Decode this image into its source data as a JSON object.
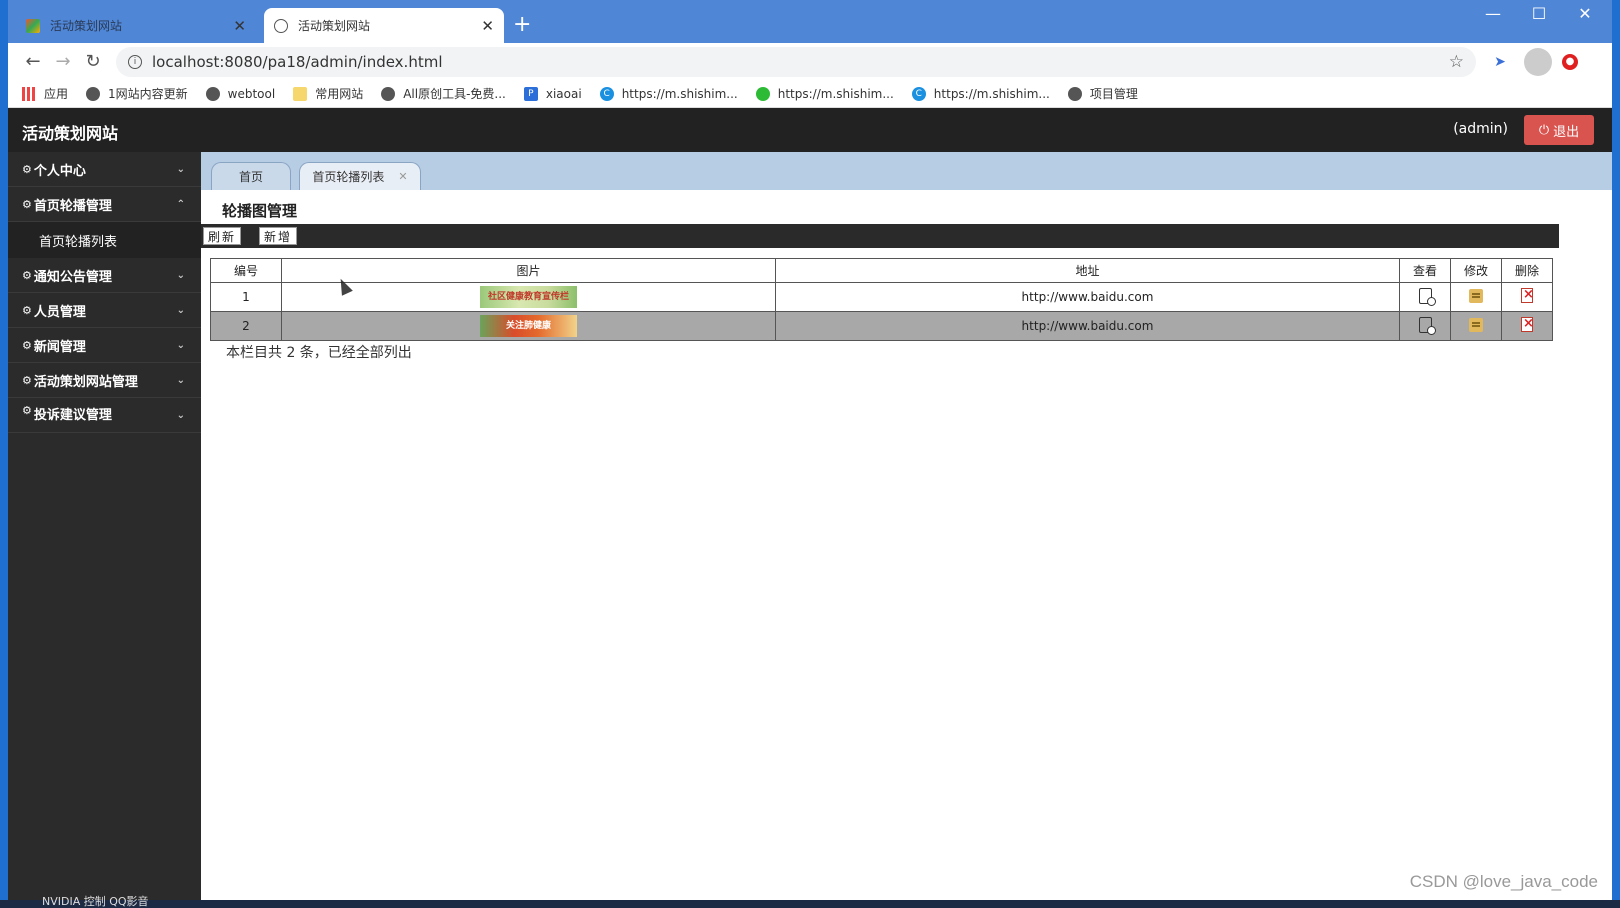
{
  "browser": {
    "tabs": [
      {
        "title": "活动策划网站",
        "active": false
      },
      {
        "title": "活动策划网站",
        "active": true
      }
    ],
    "url": "localhost:8080/pa18/admin/index.html",
    "bookmarks": [
      {
        "label": "应用",
        "icon": "apps-grid-icon"
      },
      {
        "label": "1网站内容更新",
        "icon": "globe-icon"
      },
      {
        "label": "webtool",
        "icon": "globe-icon"
      },
      {
        "label": "常用网站",
        "icon": "folder-icon"
      },
      {
        "label": "All原创工具-免费...",
        "icon": "globe-icon"
      },
      {
        "label": "xiaoai",
        "icon": "p-icon"
      },
      {
        "label": "https://m.shishim...",
        "icon": "c-icon"
      },
      {
        "label": "https://m.shishim...",
        "icon": "wechat-icon"
      },
      {
        "label": "https://m.shishim...",
        "icon": "c-icon"
      },
      {
        "label": "项目管理",
        "icon": "globe-icon"
      }
    ]
  },
  "header": {
    "title": "活动策划网站",
    "user": "(admin)",
    "logout_label": "退出",
    "logout_color": "#d9534f"
  },
  "sidebar": {
    "items": [
      {
        "label": "个人中心",
        "expanded": false
      },
      {
        "label": "首页轮播管理",
        "expanded": true,
        "children": [
          {
            "label": "首页轮播列表"
          }
        ]
      },
      {
        "label": "通知公告管理",
        "expanded": false
      },
      {
        "label": "人员管理",
        "expanded": false
      },
      {
        "label": "新闻管理",
        "expanded": false
      },
      {
        "label": "活动策划网站管理",
        "expanded": false
      },
      {
        "label": "投诉建议管理",
        "expanded": false
      }
    ]
  },
  "content_tabs": [
    {
      "label": "首页"
    },
    {
      "label": "首页轮播列表",
      "closable": true
    }
  ],
  "page": {
    "heading": "轮播图管理",
    "actions": {
      "refresh": "刷新",
      "add": "新增"
    },
    "table": {
      "headers": [
        "编号",
        "图片",
        "地址",
        "查看",
        "修改",
        "删除"
      ],
      "rows": [
        {
          "id": "1",
          "image_caption": "社区健康教育宣传栏",
          "url": "http://www.baidu.com"
        },
        {
          "id": "2",
          "image_caption": "关注肺健康",
          "url": "http://www.baidu.com"
        }
      ]
    },
    "summary": "本栏目共 2 条，已经全部列出"
  },
  "watermark": "CSDN @love_java_code",
  "taskbar": "NVIDIA 控制 QQ影音"
}
